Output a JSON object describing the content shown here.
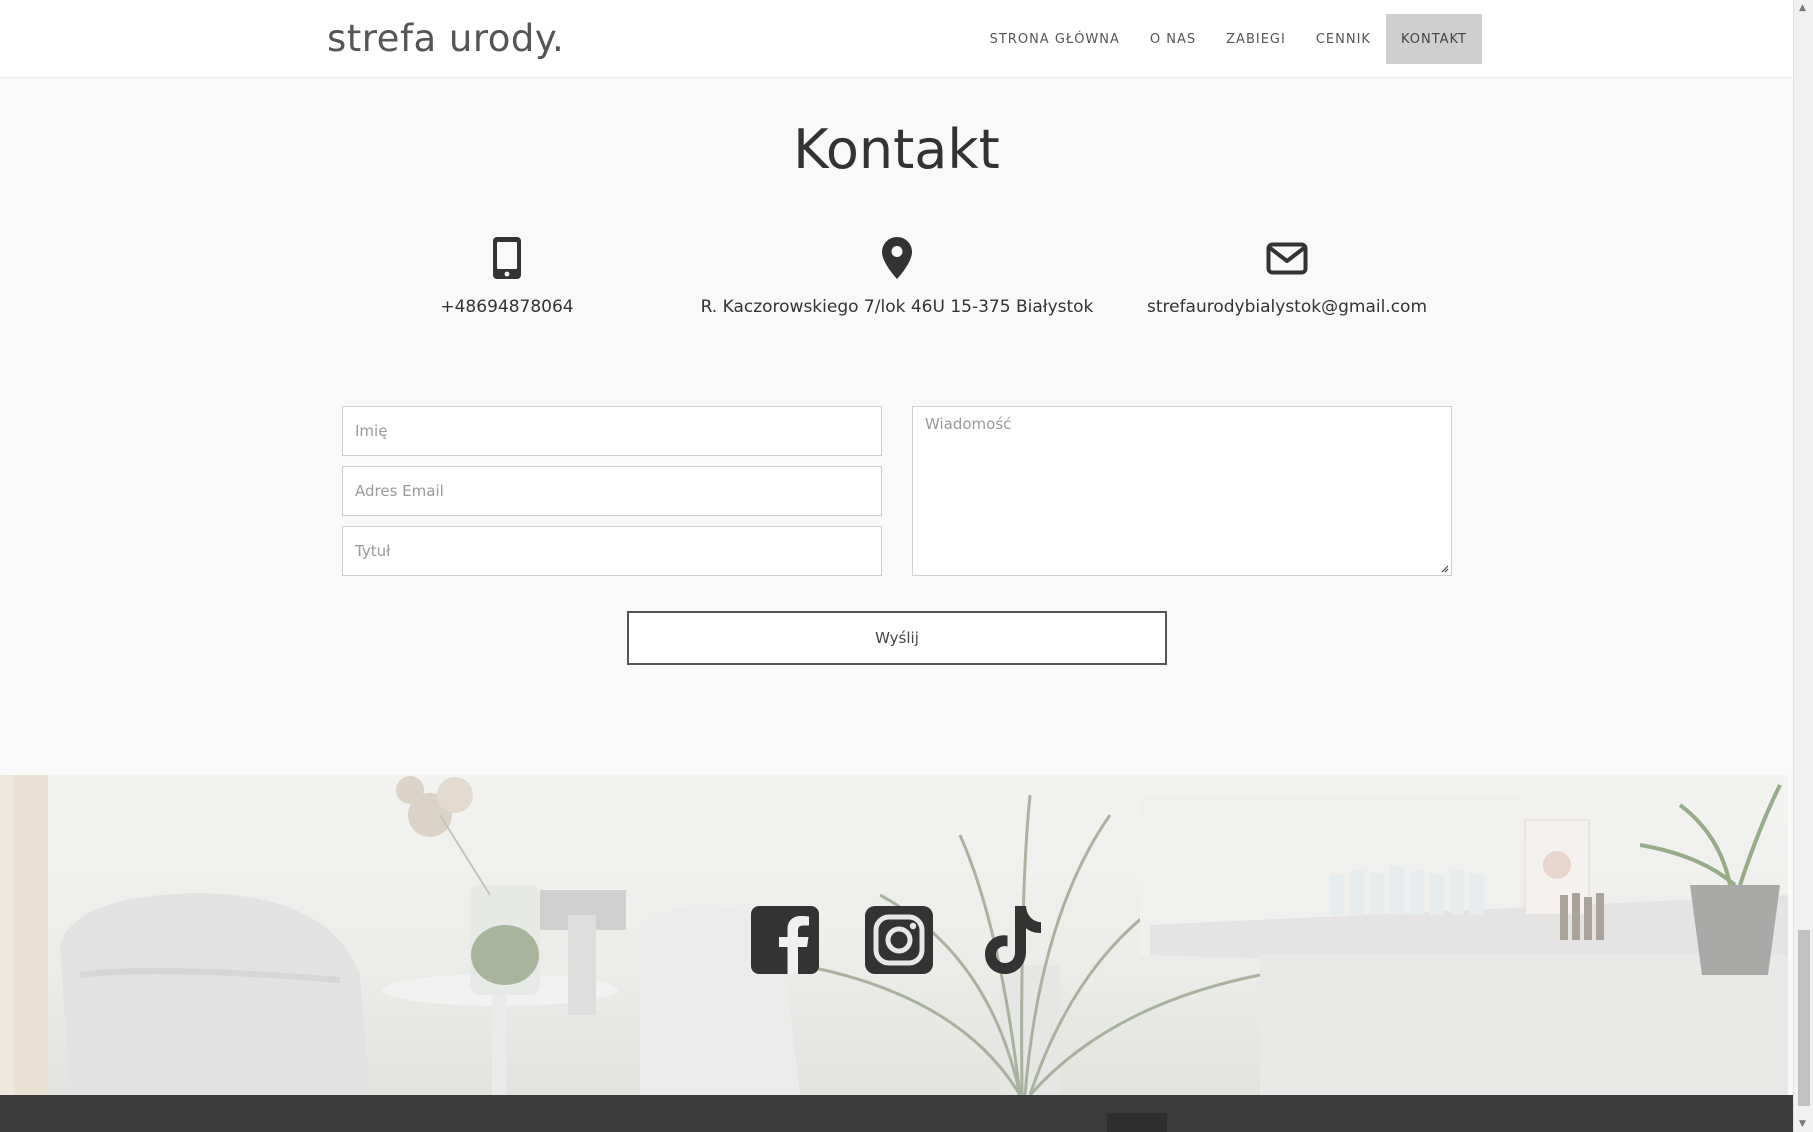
{
  "header": {
    "logo": "strefa urody.",
    "nav": [
      {
        "label": "STRONA GŁÓWNA",
        "active": false
      },
      {
        "label": "O NAS",
        "active": false
      },
      {
        "label": "ZABIEGI",
        "active": false
      },
      {
        "label": "CENNIK",
        "active": false
      },
      {
        "label": "KONTAKT",
        "active": true
      }
    ]
  },
  "contact": {
    "title": "Kontakt",
    "phone": {
      "icon": "mobile-phone-icon",
      "text": "+48694878064"
    },
    "address": {
      "icon": "map-pin-icon",
      "text": "R. Kaczorowskiego 7/lok 46U 15-375 Białystok"
    },
    "email": {
      "icon": "envelope-icon",
      "text": "strefaurodybialystok@gmail.com"
    }
  },
  "form": {
    "name_placeholder": "Imię",
    "email_placeholder": "Adres Email",
    "subject_placeholder": "Tytuł",
    "message_placeholder": "Wiadomość",
    "send_label": "Wyślij"
  },
  "social": [
    {
      "icon": "facebook-icon"
    },
    {
      "icon": "instagram-icon"
    },
    {
      "icon": "tiktok-icon"
    }
  ],
  "colors": {
    "page_bg": "#f9f9f9",
    "header_bg": "#ffffff",
    "active_nav_bg": "#cfcfcf",
    "text": "#333333",
    "footer_bg": "#3b3b3b"
  }
}
